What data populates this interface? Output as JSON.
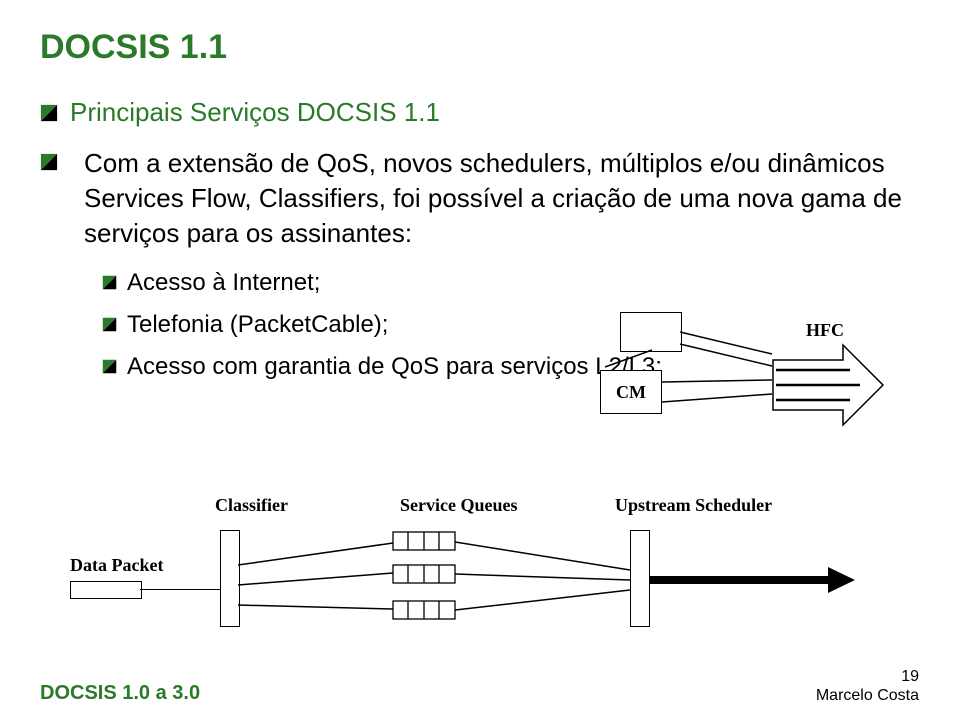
{
  "title": "DOCSIS 1.1",
  "bullet1": "Principais Serviços DOCSIS 1.1",
  "bullet2": "Com a extensão de QoS, novos schedulers, múltiplos e/ou dinâmicos Services Flow, Classifiers, foi possível a criação de uma nova gama de serviços para os assinantes:",
  "sub": {
    "a": "Acesso à Internet;",
    "b": "Telefonia (PacketCable);",
    "c": "Acesso com garantia de QoS para serviços L2/L3;"
  },
  "diagram_top": {
    "cm": "CM",
    "hfc": "HFC"
  },
  "diagram_bottom": {
    "data_packet": "Data Packet",
    "classifier": "Classifier",
    "service_queues": "Service Queues",
    "upstream_scheduler": "Upstream Scheduler"
  },
  "footer": {
    "left": "DOCSIS 1.0 a 3.0",
    "page": "19",
    "author": "Marcelo Costa"
  },
  "colors": {
    "green": "#2a7a2a"
  }
}
